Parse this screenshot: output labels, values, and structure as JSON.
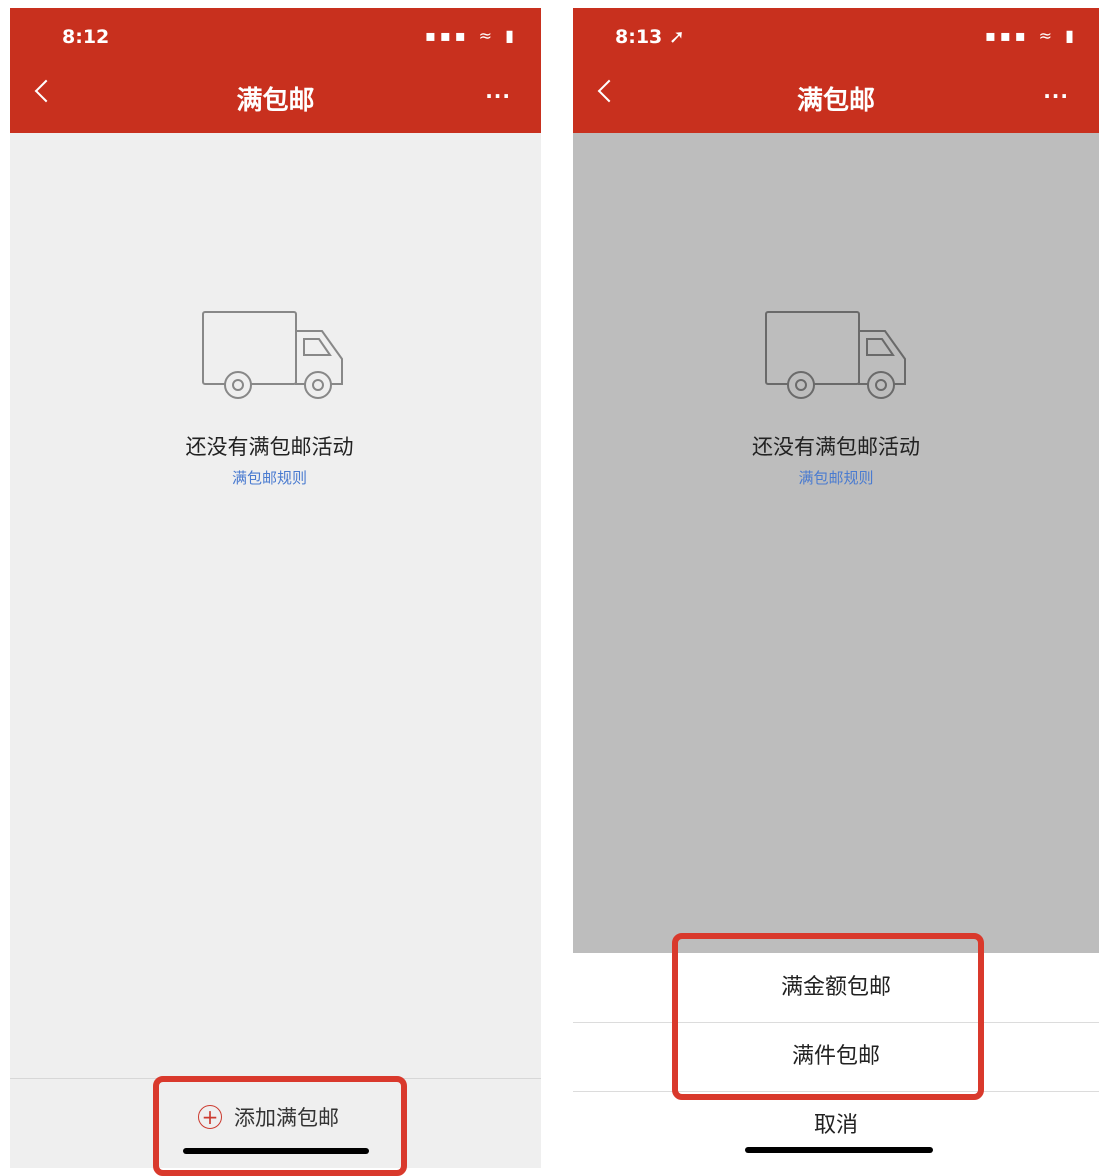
{
  "left": {
    "status": {
      "time": "8:12",
      "icons": "▪▪▪ ≈ ▮"
    },
    "nav": {
      "back": "‹",
      "title": "满包邮",
      "more": "···"
    },
    "empty": {
      "text": "还没有满包邮活动",
      "link": "满包邮规则"
    },
    "footer": {
      "add_label": "添加满包邮",
      "plus": "+"
    }
  },
  "right": {
    "status": {
      "time": "8:13 ➚",
      "icons": "▪▪▪ ≈ ▮"
    },
    "nav": {
      "back": "‹",
      "title": "满包邮",
      "more": "···"
    },
    "empty": {
      "text": "还没有满包邮活动",
      "link": "满包邮规则"
    },
    "sheet": {
      "option_amount": "满金额包邮",
      "option_count": "满件包邮",
      "cancel": "取消"
    }
  },
  "colors": {
    "header": "#c8301e",
    "highlight": "#d9392c",
    "link": "#4a7bd0",
    "overlay": "#bdbdbd"
  }
}
